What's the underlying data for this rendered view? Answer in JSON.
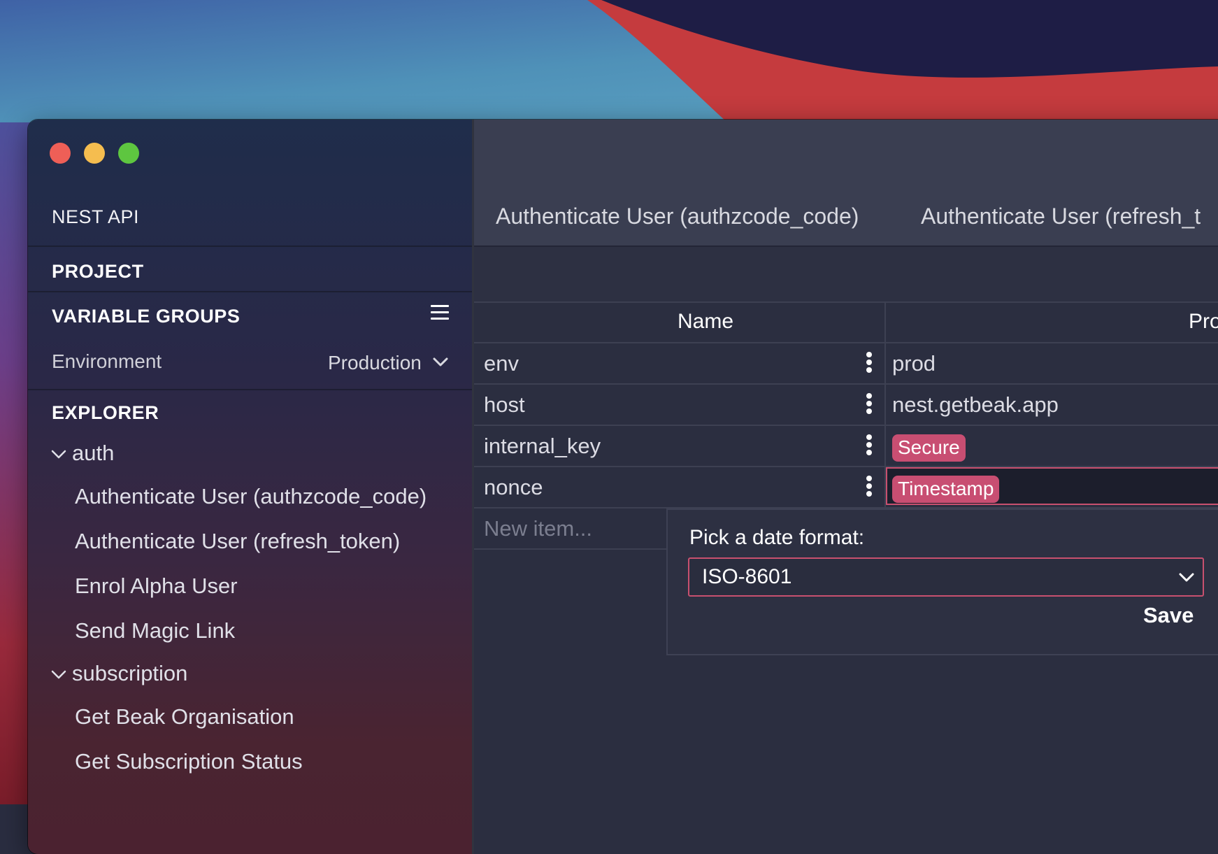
{
  "sidebar": {
    "project_title": "NEST API",
    "project_label": "PROJECT",
    "variable_groups_label": "VARIABLE GROUPS",
    "environment_label": "Environment",
    "environment_value": "Production",
    "explorer_label": "EXPLORER",
    "groups": [
      {
        "label": "auth",
        "items": [
          "Authenticate User (authzcode_code)",
          "Authenticate User (refresh_token)",
          "Enrol Alpha User",
          "Send Magic Link"
        ]
      },
      {
        "label": "subscription",
        "items": [
          "Get Beak Organisation",
          "Get Subscription Status"
        ]
      }
    ]
  },
  "tabs": [
    "Authenticate User (authzcode_code)",
    "Authenticate User (refresh_t"
  ],
  "table": {
    "columns": [
      "Name",
      "Produ"
    ],
    "rows": [
      {
        "name": "env",
        "value": "prod"
      },
      {
        "name": "host",
        "value": "nest.getbeak.app"
      },
      {
        "name": "internal_key",
        "badge": "Secure"
      },
      {
        "name": "nonce",
        "badge": "Timestamp"
      }
    ],
    "new_item_placeholder": "New item..."
  },
  "popover": {
    "label": "Pick a date format:",
    "selected": "ISO-8601",
    "save_label": "Save"
  },
  "colors": {
    "accent": "#c84e72",
    "traffic_close": "#ee5f57",
    "traffic_min": "#f5bd4f",
    "traffic_max": "#5ec640"
  }
}
